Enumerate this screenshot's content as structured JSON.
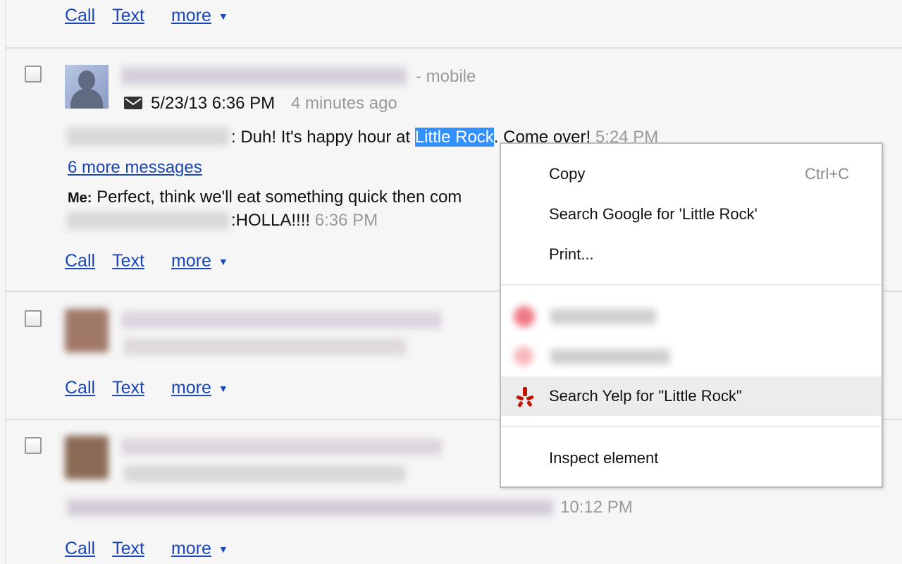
{
  "actions": {
    "call": "Call",
    "text": "Text",
    "more": "more"
  },
  "conversation": {
    "phone_type": "- mobile",
    "date": "5/23/13 6:36 PM",
    "relative_time": "4 minutes ago",
    "messages": [
      {
        "text": "Duh! It's happy hour at ",
        "selected": "Little Rock",
        "after": ". Come over!",
        "time": "5:24 PM"
      },
      {
        "sender": "Me:",
        "text": "Perfect, think we'll eat something quick then com"
      },
      {
        "text": "HOLLA!!!!",
        "time": "6:36 PM"
      }
    ],
    "more_messages": "6 more messages"
  },
  "conversation3": {
    "time": "10:12 PM"
  },
  "context_menu": {
    "copy": "Copy",
    "copy_shortcut": "Ctrl+C",
    "search_google": "Search Google for 'Little Rock'",
    "print": "Print...",
    "search_yelp": "Search Yelp for \"Little Rock\"",
    "inspect": "Inspect element"
  },
  "colors": {
    "link": "#1b46b8",
    "selection": "#3390ff",
    "yelp": "#c41200"
  },
  "icons": [
    "envelope-icon",
    "yelp-icon",
    "dropdown-triangle-icon"
  ]
}
